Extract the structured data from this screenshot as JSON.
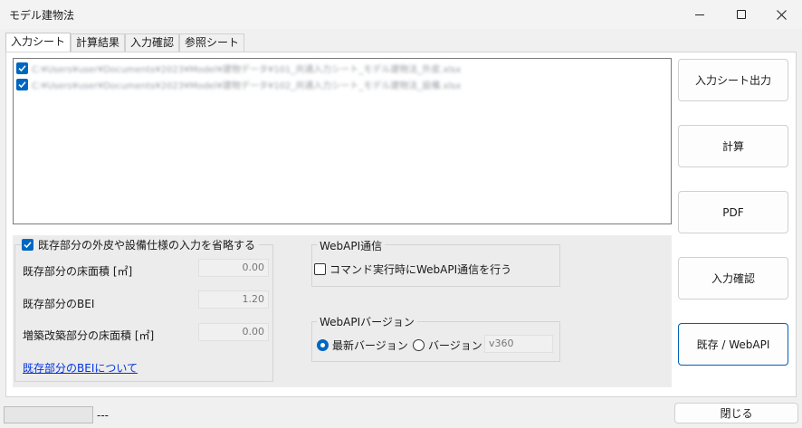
{
  "window": {
    "title": "モデル建物法",
    "minimize_icon": "minimize-icon",
    "maximize_icon": "maximize-icon",
    "close_icon": "close-icon"
  },
  "tabs": [
    {
      "label": "入力シート",
      "active": true
    },
    {
      "label": "計算結果",
      "active": false
    },
    {
      "label": "入力確認",
      "active": false
    },
    {
      "label": "参照シート",
      "active": false
    }
  ],
  "files": [
    {
      "checked": true,
      "path": "C:¥Users¥user¥Documents¥2023¥Model¥建物データ¥101_共通入力シート_モデル建物法_外皮.xlsx"
    },
    {
      "checked": true,
      "path": "C:¥Users¥user¥Documents¥2023¥Model¥建物データ¥102_共通入力シート_モデル建物法_設備.xlsx"
    }
  ],
  "existing": {
    "omit_label": "既存部分の外皮や設備仕様の入力を省略する",
    "omit_checked": true,
    "floor_area_label": "既存部分の床面積 [㎡]",
    "floor_area_value": "0.00",
    "bei_label": "既存部分のBEI",
    "bei_value": "1.20",
    "addition_area_label": "増築改築部分の床面積 [㎡]",
    "addition_area_value": "0.00",
    "bei_link": "既存部分のBEIについて"
  },
  "webapi": {
    "group_title": "WebAPI通信",
    "command_label": "コマンド実行時にWebAPI通信を行う",
    "command_checked": false
  },
  "version": {
    "group_title": "WebAPIバージョン",
    "latest_label": "最新バージョン",
    "latest_selected": true,
    "specific_label": "バージョン",
    "specific_value": "v360"
  },
  "buttons": {
    "export": "入力シート出力",
    "calculate": "計算",
    "pdf": "PDF",
    "check": "入力確認",
    "existing_webapi": "既存 / WebAPI"
  },
  "status": {
    "text": "---",
    "close_label": "閉じる"
  },
  "colors": {
    "accent": "#0067c0",
    "link": "#0033dd"
  }
}
